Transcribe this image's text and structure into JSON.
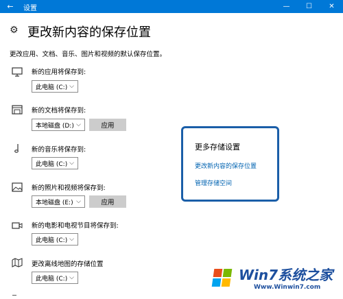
{
  "window": {
    "title": "设置",
    "back_glyph": "←",
    "minimize_glyph": "—",
    "maximize_glyph": "☐",
    "close_glyph": "✕"
  },
  "page": {
    "title": "更改新内容的保存位置",
    "description": "更改应用、文档、音乐、图片和视频的默认保存位置。"
  },
  "rows": [
    {
      "icon": "monitor-icon",
      "label": "新的应用将保存到:",
      "value": "此电脑 (C:)",
      "has_apply": false
    },
    {
      "icon": "document-icon",
      "label": "新的文档将保存到:",
      "value": "本地磁盘 (D:)",
      "has_apply": true
    },
    {
      "icon": "music-note-icon",
      "label": "新的音乐将保存到:",
      "value": "此电脑 (C:)",
      "has_apply": false
    },
    {
      "icon": "image-icon",
      "label": "新的照片和视频将保存到:",
      "value": "本地磁盘 (E:)",
      "has_apply": true
    },
    {
      "icon": "video-camera-icon",
      "label": "新的电影和电视节目将保存到:",
      "value": "此电脑 (C:)",
      "has_apply": false
    },
    {
      "icon": "map-icon",
      "label": "更改离线地图的存储位置",
      "value": "此电脑 (C:)",
      "has_apply": false
    }
  ],
  "apply_label": "应用",
  "more": {
    "title": "更多存储设置",
    "link1": "更改新内容的保存位置",
    "link2": "管理存储空间",
    "border_color": "#1a5ea8"
  },
  "watermark": {
    "brand": "Win7系统之家",
    "url": "Www.Winwin7.com"
  },
  "colors": {
    "accent": "#0078d7",
    "link": "#0063b1"
  }
}
